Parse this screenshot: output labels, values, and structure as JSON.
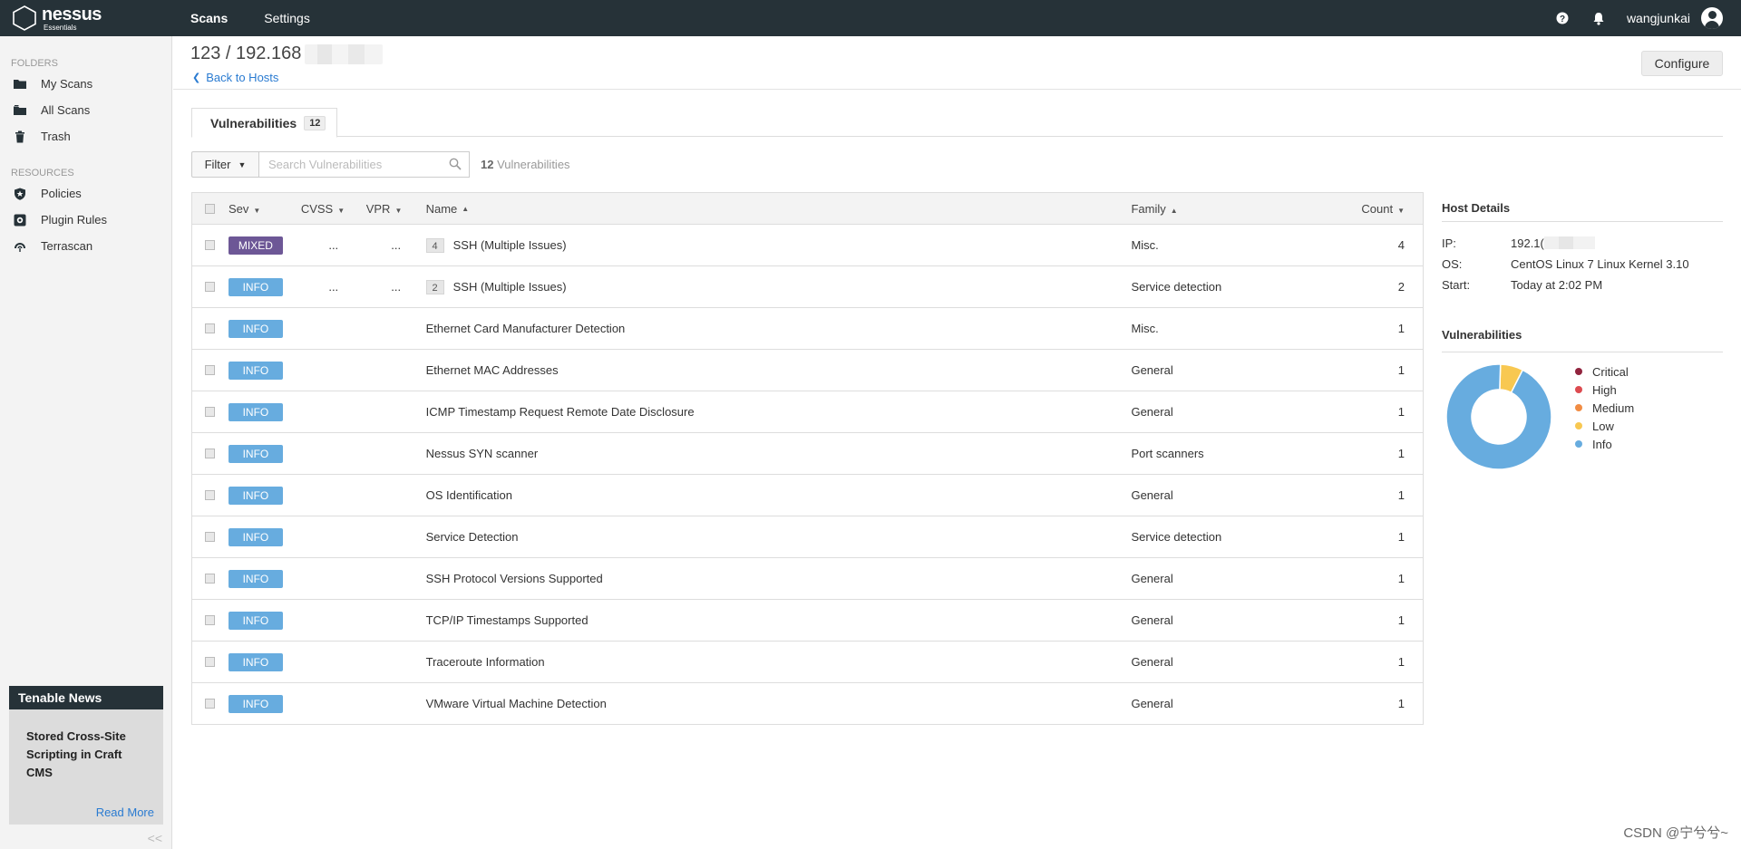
{
  "app": {
    "brand": "nessus",
    "edition": "Essentials"
  },
  "topnav": [
    {
      "label": "Scans",
      "active": true
    },
    {
      "label": "Settings",
      "active": false
    }
  ],
  "header_right": {
    "help_icon": "help-circle-icon",
    "bell_icon": "bell-icon",
    "username": "wangjunkai",
    "avatar_icon": "user-avatar-icon"
  },
  "sidebar": {
    "folders_heading": "FOLDERS",
    "folders": [
      {
        "label": "My Scans",
        "icon": "folder-icon"
      },
      {
        "label": "All Scans",
        "icon": "folders-icon"
      },
      {
        "label": "Trash",
        "icon": "trash-icon"
      }
    ],
    "resources_heading": "RESOURCES",
    "resources": [
      {
        "label": "Policies",
        "icon": "shield-icon"
      },
      {
        "label": "Plugin Rules",
        "icon": "plugin-rules-icon"
      },
      {
        "label": "Terrascan",
        "icon": "terrascan-icon"
      }
    ],
    "news": {
      "heading": "Tenable News",
      "title": "Stored Cross-Site Scripting in Craft CMS",
      "read_more": "Read More"
    },
    "collapse_label": "<<"
  },
  "page": {
    "title": "123 / 192.168",
    "back_link": "Back to Hosts",
    "configure": "Configure"
  },
  "tabs": [
    {
      "label": "Vulnerabilities",
      "count": "12"
    }
  ],
  "filter": {
    "button": "Filter",
    "search_placeholder": "Search Vulnerabilities",
    "count_value": "12",
    "count_label": "Vulnerabilities"
  },
  "table": {
    "headers": {
      "sev": "Sev",
      "cvss": "CVSS",
      "vpr": "VPR",
      "name": "Name",
      "family": "Family",
      "count": "Count"
    },
    "rows": [
      {
        "sev": "MIXED",
        "cvss": "...",
        "vpr": "...",
        "group": "4",
        "name": "SSH (Multiple Issues)",
        "family": "Misc.",
        "count": "4"
      },
      {
        "sev": "INFO",
        "cvss": "...",
        "vpr": "...",
        "group": "2",
        "name": "SSH (Multiple Issues)",
        "family": "Service detection",
        "count": "2"
      },
      {
        "sev": "INFO",
        "cvss": "",
        "vpr": "",
        "group": "",
        "name": "Ethernet Card Manufacturer Detection",
        "family": "Misc.",
        "count": "1"
      },
      {
        "sev": "INFO",
        "cvss": "",
        "vpr": "",
        "group": "",
        "name": "Ethernet MAC Addresses",
        "family": "General",
        "count": "1"
      },
      {
        "sev": "INFO",
        "cvss": "",
        "vpr": "",
        "group": "",
        "name": "ICMP Timestamp Request Remote Date Disclosure",
        "family": "General",
        "count": "1"
      },
      {
        "sev": "INFO",
        "cvss": "",
        "vpr": "",
        "group": "",
        "name": "Nessus SYN scanner",
        "family": "Port scanners",
        "count": "1"
      },
      {
        "sev": "INFO",
        "cvss": "",
        "vpr": "",
        "group": "",
        "name": "OS Identification",
        "family": "General",
        "count": "1"
      },
      {
        "sev": "INFO",
        "cvss": "",
        "vpr": "",
        "group": "",
        "name": "Service Detection",
        "family": "Service detection",
        "count": "1"
      },
      {
        "sev": "INFO",
        "cvss": "",
        "vpr": "",
        "group": "",
        "name": "SSH Protocol Versions Supported",
        "family": "General",
        "count": "1"
      },
      {
        "sev": "INFO",
        "cvss": "",
        "vpr": "",
        "group": "",
        "name": "TCP/IP Timestamps Supported",
        "family": "General",
        "count": "1"
      },
      {
        "sev": "INFO",
        "cvss": "",
        "vpr": "",
        "group": "",
        "name": "Traceroute Information",
        "family": "General",
        "count": "1"
      },
      {
        "sev": "INFO",
        "cvss": "",
        "vpr": "",
        "group": "",
        "name": "VMware Virtual Machine Detection",
        "family": "General",
        "count": "1"
      }
    ]
  },
  "host_details": {
    "heading": "Host Details",
    "ip_label": "IP:",
    "ip_value": "192.1(",
    "os_label": "OS:",
    "os_value": "CentOS Linux 7 Linux Kernel 3.10",
    "start_label": "Start:",
    "start_value": "Today at 2:02 PM"
  },
  "vuln_chart": {
    "heading": "Vulnerabilities",
    "legend": [
      {
        "label": "Critical",
        "color": "#91243e"
      },
      {
        "label": "High",
        "color": "#dd4b50"
      },
      {
        "label": "Medium",
        "color": "#f18c43"
      },
      {
        "label": "Low",
        "color": "#f8c851"
      },
      {
        "label": "Info",
        "color": "#67acdf"
      }
    ],
    "slices": [
      {
        "label": "Low",
        "fraction": 0.07
      },
      {
        "label": "Info",
        "fraction": 0.93
      }
    ]
  },
  "colors": {
    "mixed": "#6d5796",
    "info": "#67acdf",
    "topbar": "#263238",
    "link": "#2a7bd1"
  },
  "watermark": "CSDN @宁兮兮~"
}
